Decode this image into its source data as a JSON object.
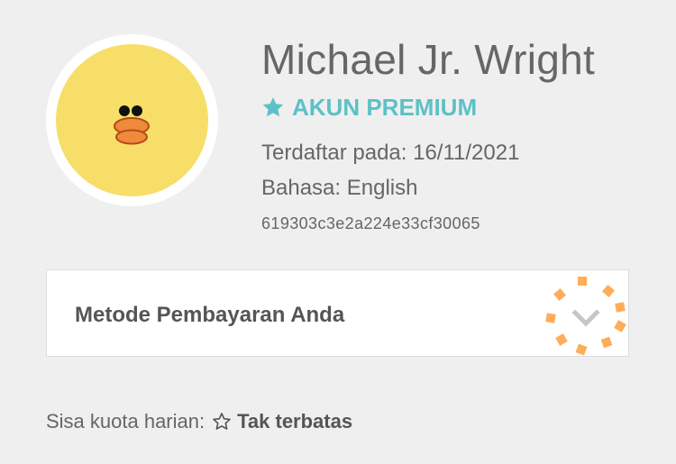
{
  "profile": {
    "name": "Michael Jr. Wright",
    "badge_label": "AKUN PREMIUM",
    "registered_label": "Terdaftar pada: 16/11/2021",
    "language_label": "Bahasa: English",
    "user_id": "619303c3e2a224e33cf30065"
  },
  "payment": {
    "title": "Metode Pembayaran Anda"
  },
  "quota": {
    "label": "Sisa kuota harian:",
    "value": "Tak terbatas"
  },
  "colors": {
    "premium_accent": "#5cc1c6",
    "avatar_fill": "#f7de68",
    "beak": "#ef8a3b",
    "highlight_marker": "#ffad59",
    "background": "#efefef"
  },
  "icons": {
    "avatar": "duck-character-icon",
    "premium": "star-icon",
    "expand": "chevron-down-icon",
    "quota": "star-outline-icon"
  }
}
